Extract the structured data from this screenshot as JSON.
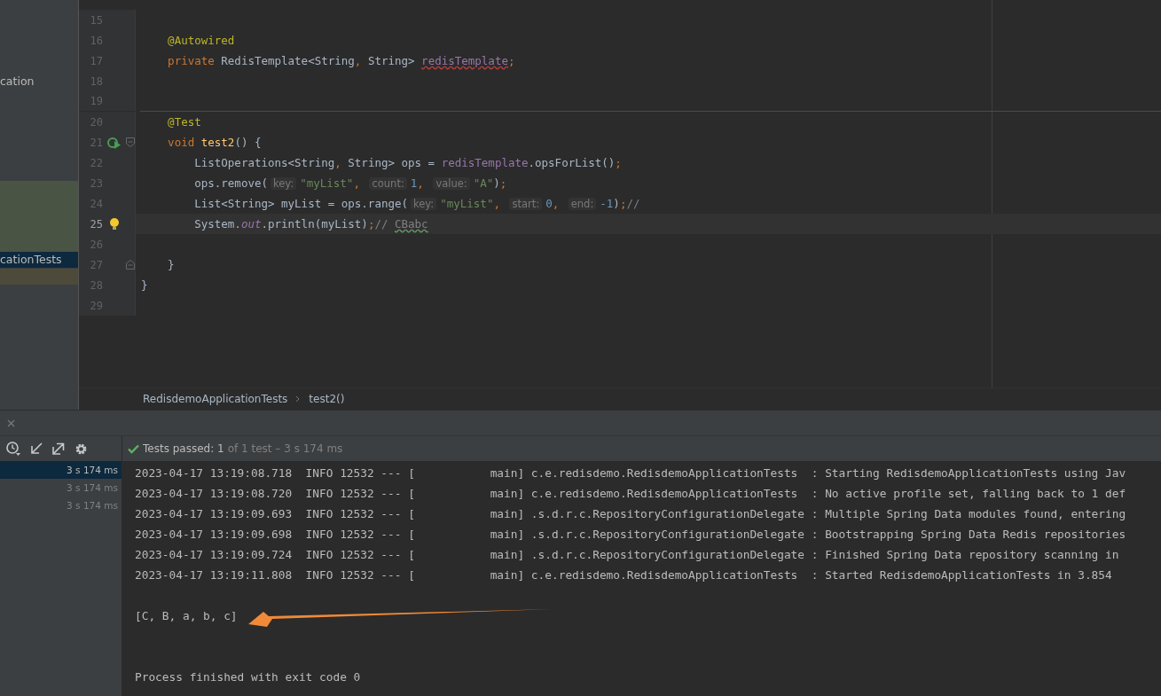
{
  "project_tree": [
    {
      "label": "cation",
      "selected": false
    },
    {
      "label": "cationTests",
      "selected": true
    }
  ],
  "editor": {
    "lines": [
      {
        "number": "15",
        "current": false
      },
      {
        "number": "16",
        "current": false,
        "tokens": [
          {
            "kind": "annot",
            "text": "    @Autowired"
          }
        ]
      },
      {
        "number": "17",
        "current": false,
        "tokens": [
          {
            "kind": "kw",
            "text": "    private "
          },
          {
            "kind": "plain",
            "text": "RedisTemplate<String"
          },
          {
            "kind": "kw",
            "text": ", "
          },
          {
            "kind": "plain",
            "text": "String> "
          },
          {
            "kind": "field",
            "text": "redisTemplate",
            "error": true
          },
          {
            "kind": "kw",
            "text": ";"
          }
        ]
      },
      {
        "number": "18",
        "current": false
      },
      {
        "number": "19",
        "current": false,
        "separator": true
      },
      {
        "number": "20",
        "current": false,
        "tokens": [
          {
            "kind": "annot",
            "text": "    @Test"
          }
        ]
      },
      {
        "number": "21",
        "current": false,
        "run_marker": true,
        "fold_start": true,
        "tokens": [
          {
            "kind": "kw",
            "text": "    void "
          },
          {
            "kind": "method",
            "text": "test2"
          },
          {
            "kind": "plain",
            "text": "() {"
          }
        ]
      },
      {
        "number": "22",
        "current": false,
        "tokens": [
          {
            "kind": "plain",
            "text": "        ListOperations<String"
          },
          {
            "kind": "kw",
            "text": ", "
          },
          {
            "kind": "plain",
            "text": "String> ops = "
          },
          {
            "kind": "field",
            "text": "redisTemplate"
          },
          {
            "kind": "plain",
            "text": ".opsForList()"
          },
          {
            "kind": "kw",
            "text": ";"
          }
        ]
      },
      {
        "number": "23",
        "current": false,
        "tokens": [
          {
            "kind": "plain",
            "text": "        ops.remove("
          },
          {
            "kind": "hint",
            "text": "key:"
          },
          {
            "kind": "str",
            "text": "\"myList\""
          },
          {
            "kind": "kw",
            "text": ", "
          },
          {
            "kind": "hint",
            "text": "count:"
          },
          {
            "kind": "num",
            "text": "1"
          },
          {
            "kind": "kw",
            "text": ", "
          },
          {
            "kind": "hint",
            "text": "value:"
          },
          {
            "kind": "str",
            "text": "\"A\""
          },
          {
            "kind": "plain",
            "text": ")"
          },
          {
            "kind": "kw",
            "text": ";"
          }
        ]
      },
      {
        "number": "24",
        "current": false,
        "tokens": [
          {
            "kind": "plain",
            "text": "        List<String> myList = ops.range("
          },
          {
            "kind": "hint",
            "text": "key:"
          },
          {
            "kind": "str",
            "text": "\"myList\""
          },
          {
            "kind": "kw",
            "text": ", "
          },
          {
            "kind": "hint",
            "text": "start:"
          },
          {
            "kind": "num",
            "text": "0"
          },
          {
            "kind": "kw",
            "text": ", "
          },
          {
            "kind": "hint",
            "text": "end:"
          },
          {
            "kind": "num",
            "text": "-1"
          },
          {
            "kind": "plain",
            "text": ")"
          },
          {
            "kind": "kw",
            "text": ";"
          },
          {
            "kind": "comment",
            "text": "//"
          }
        ]
      },
      {
        "number": "25",
        "current": true,
        "bulb": true,
        "tokens": [
          {
            "kind": "plain",
            "text": "        System."
          },
          {
            "kind": "static",
            "text": "out"
          },
          {
            "kind": "plain",
            "text": ".println(myList)"
          },
          {
            "kind": "kw",
            "text": ";"
          },
          {
            "kind": "comment",
            "text": "// "
          },
          {
            "kind": "comment",
            "text": "CBabc",
            "typo": true
          }
        ]
      },
      {
        "number": "26",
        "current": false
      },
      {
        "number": "27",
        "current": false,
        "fold_end": true,
        "tokens": [
          {
            "kind": "plain",
            "text": "    }"
          }
        ]
      },
      {
        "number": "28",
        "current": false,
        "tokens": [
          {
            "kind": "plain",
            "text": "}"
          }
        ]
      },
      {
        "number": "29",
        "current": false
      }
    ]
  },
  "breadcrumbs": [
    "RedisdemoApplicationTests",
    "test2()"
  ],
  "test_tree": [
    {
      "duration": "3 s 174 ms",
      "selected": true
    },
    {
      "duration": "3 s 174 ms",
      "selected": false
    },
    {
      "duration": "3 s 174 ms",
      "selected": false
    }
  ],
  "status": {
    "passed": "Tests passed: 1",
    "detail": "of 1 test – 3 s 174 ms"
  },
  "console": [
    {
      "kind": "log",
      "text": "2023-04-17 13:19:08.718  INFO 12532 --- [           main] c.e.redisdemo.RedisdemoApplicationTests  : Starting RedisdemoApplicationTests using Jav"
    },
    {
      "kind": "log",
      "text": "2023-04-17 13:19:08.720  INFO 12532 --- [           main] c.e.redisdemo.RedisdemoApplicationTests  : No active profile set, falling back to 1 def"
    },
    {
      "kind": "log",
      "text": "2023-04-17 13:19:09.693  INFO 12532 --- [           main] .s.d.r.c.RepositoryConfigurationDelegate : Multiple Spring Data modules found, entering"
    },
    {
      "kind": "log",
      "text": "2023-04-17 13:19:09.698  INFO 12532 --- [           main] .s.d.r.c.RepositoryConfigurationDelegate : Bootstrapping Spring Data Redis repositories"
    },
    {
      "kind": "log",
      "text": "2023-04-17 13:19:09.724  INFO 12532 --- [           main] .s.d.r.c.RepositoryConfigurationDelegate : Finished Spring Data repository scanning in"
    },
    {
      "kind": "log",
      "text": "2023-04-17 13:19:11.808  INFO 12532 --- [           main] c.e.redisdemo.RedisdemoApplicationTests  : Started RedisdemoApplicationTests in 3.854"
    },
    {
      "kind": "output",
      "text": "[C, B, a, b, c]"
    },
    {
      "kind": "exit",
      "text": "Process finished with exit code 0"
    }
  ]
}
